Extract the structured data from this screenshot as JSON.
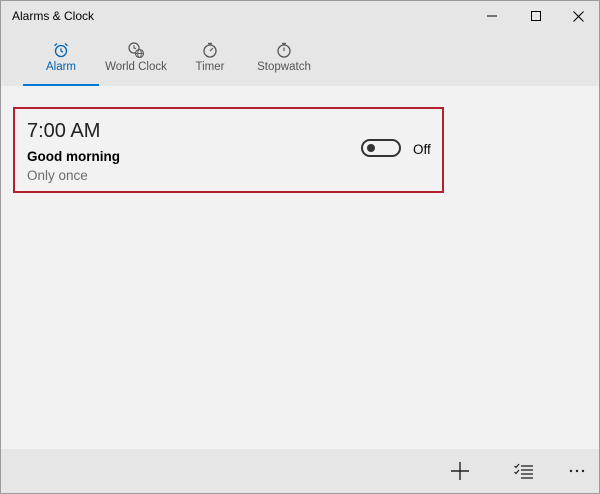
{
  "window": {
    "title": "Alarms & Clock",
    "controls": [
      "minimize-icon",
      "maximize-icon",
      "close-icon"
    ]
  },
  "tabs": [
    {
      "label": "Alarm",
      "icon": "alarm-clock-icon",
      "active": true
    },
    {
      "label": "World Clock",
      "icon": "world-clock-icon",
      "active": false
    },
    {
      "label": "Timer",
      "icon": "timer-icon",
      "active": false
    },
    {
      "label": "Stopwatch",
      "icon": "stopwatch-icon",
      "active": false
    }
  ],
  "alarms": [
    {
      "time": "7:00 AM",
      "name": "Good morning",
      "repeat": "Only once",
      "toggle_state": "Off",
      "enabled": false
    }
  ],
  "bottom_bar": {
    "buttons": [
      "add-icon",
      "select-icon",
      "more-icon"
    ]
  },
  "colors": {
    "accent": "#0078d7",
    "highlight_border": "#b51f2e",
    "chrome": "#e6e6e6",
    "background": "#f2f2f2"
  }
}
